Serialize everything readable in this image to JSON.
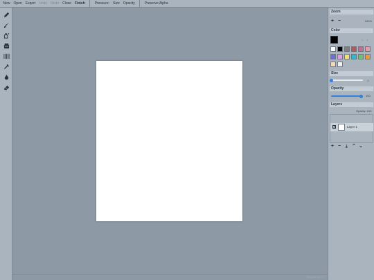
{
  "menu": {
    "new": "New",
    "open": "Open",
    "export": "Export",
    "undo": "Undo",
    "redo": "Redo",
    "close": "Close",
    "finish": "Finish",
    "pressure": "Pressure:",
    "size": "Size",
    "opacity": "Opacity",
    "preserve_alpha": "Preserve Alpha"
  },
  "tools": [
    {
      "name": "pencil-icon"
    },
    {
      "name": "brush-icon"
    },
    {
      "name": "bucket-icon"
    },
    {
      "name": "stamp-icon"
    },
    {
      "name": "hatch-icon"
    },
    {
      "name": "eyedropper-icon"
    },
    {
      "name": "blur-drop-icon"
    },
    {
      "name": "eraser-icon"
    }
  ],
  "zoom": {
    "title": "Zoom",
    "in": "+",
    "out": "−",
    "value": "100%"
  },
  "color": {
    "title": "Color",
    "arrows": "↑↓",
    "chevron": "›",
    "primary": "#000000",
    "swatches": [
      "#ffffff",
      "#000000",
      "#808080",
      "#b05a5a",
      "#c07090",
      "#e89aa8",
      "#6f6fd0",
      "#e0a0e0",
      "#f0e07a",
      "#30b8c8",
      "#70c070",
      "#e89a40",
      "#f5d8b8",
      "#f0f0f0"
    ]
  },
  "size": {
    "title": "Size",
    "value": "1",
    "level": 0
  },
  "opacity": {
    "title": "Opacity",
    "value": "100",
    "level": 1
  },
  "layers": {
    "title": "Layers",
    "opacity_label": "Opacity: 100",
    "items": [
      {
        "name": "Layer 1",
        "visible_mark": "✕"
      }
    ],
    "controls": {
      "add": "+",
      "remove": "−",
      "merge": "⤓",
      "up": "⌃",
      "down": "⌄"
    }
  },
  "status": {
    "version": "Sugarbrush 0.1"
  }
}
